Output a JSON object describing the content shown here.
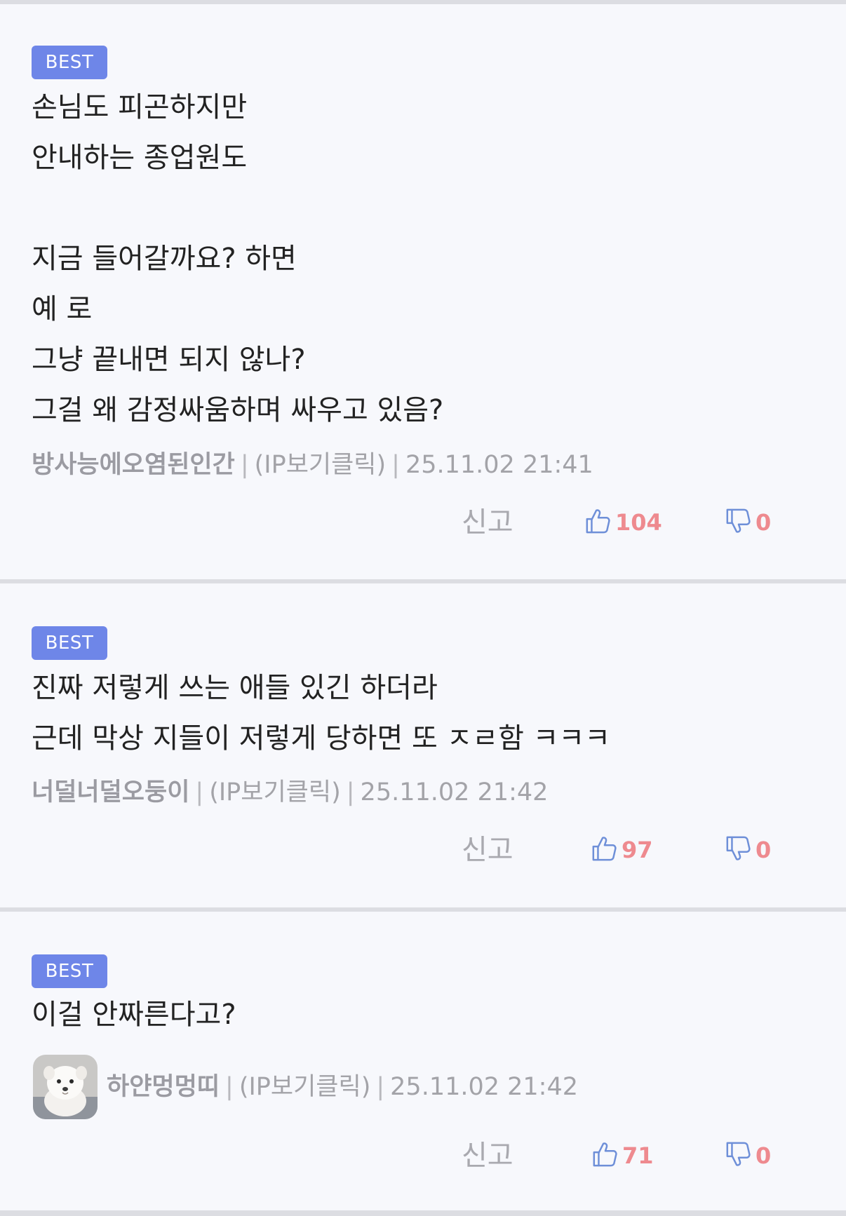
{
  "colors": {
    "badge_bg": "#6e86e8",
    "count": "#ee8a8f",
    "icon_stroke": "#6e8fd8",
    "divider": "#dcdde2"
  },
  "comments": [
    {
      "badge": "BEST",
      "text": "손님도 피곤하지만\n안내하는 종업원도\n\n지금 들어갈까요? 하면\n예 로\n그냥 끝내면 되지 않나?\n그걸 왜 감정싸움하며 싸우고 있음?",
      "nickname": "방사능에오염된인간",
      "ip": "(IP보기클릭)",
      "time": "25.11.02 21:41",
      "report": "신고",
      "likes": "104",
      "dislikes": "0",
      "like_icon": "thumbs-up-icon",
      "dislike_icon": "thumbs-down-icon"
    },
    {
      "badge": "BEST",
      "text": "진짜 저렇게 쓰는 애들 있긴 하더라\n근데 막상 지들이 저렇게 당하면 또 ㅈㄹ함 ㅋㅋㅋ",
      "nickname": "너덜너덜오둥이",
      "ip": "(IP보기클릭)",
      "time": "25.11.02 21:42",
      "report": "신고",
      "likes": "97",
      "dislikes": "0",
      "like_icon": "thumbs-up-icon",
      "dislike_icon": "thumbs-down-icon"
    },
    {
      "badge": "BEST",
      "text": "이걸 안짜른다고?",
      "nickname": "하얀멍멍띠",
      "ip": "(IP보기클릭)",
      "time": "25.11.02 21:42",
      "report": "신고",
      "likes": "71",
      "dislikes": "0",
      "avatar_icon": "white-puppy-avatar",
      "like_icon": "thumbs-up-icon",
      "dislike_icon": "thumbs-down-icon"
    }
  ]
}
